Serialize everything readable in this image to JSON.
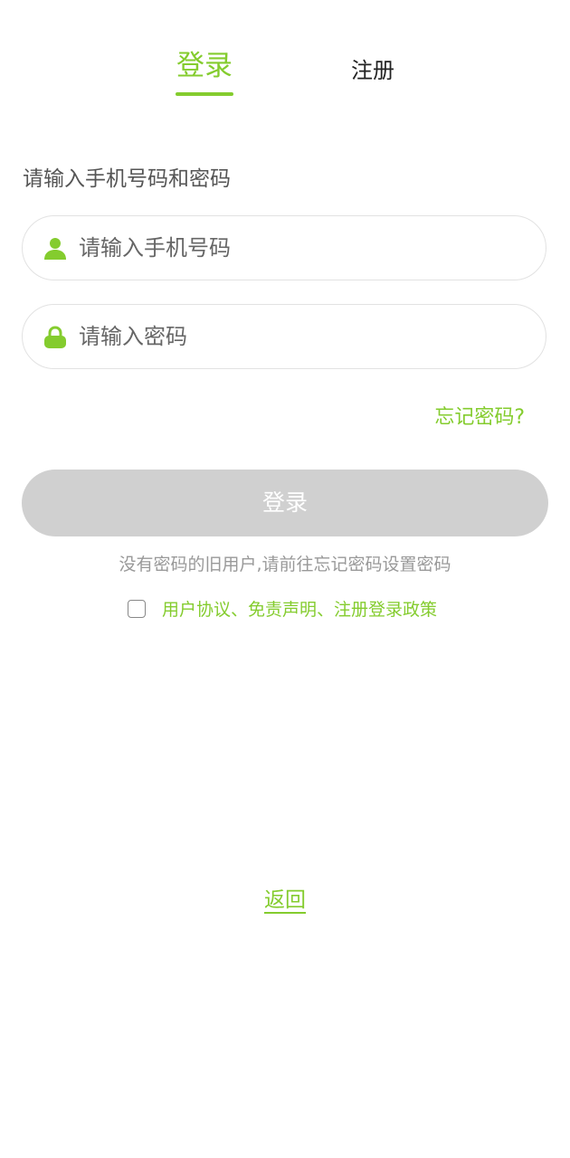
{
  "tabs": {
    "login_label": "登录",
    "register_label": "注册"
  },
  "form": {
    "prompt": "请输入手机号码和密码",
    "phone_placeholder": "请输入手机号码",
    "phone_value": "",
    "password_placeholder": "请输入密码",
    "password_value": "",
    "phone_icon": "user-icon",
    "password_icon": "lock-icon",
    "forgot_label": "忘记密码?",
    "login_button_label": "登录"
  },
  "hint_text": "没有密码的旧用户,请前往忘记密码设置密码",
  "agreement": {
    "checked": false,
    "text": "用户协议、免责声明、注册登录政策"
  },
  "back_label": "返回",
  "colors": {
    "accent": "#84cc2e",
    "button_disabled": "#d0d0d0",
    "hint_text": "#999999"
  }
}
